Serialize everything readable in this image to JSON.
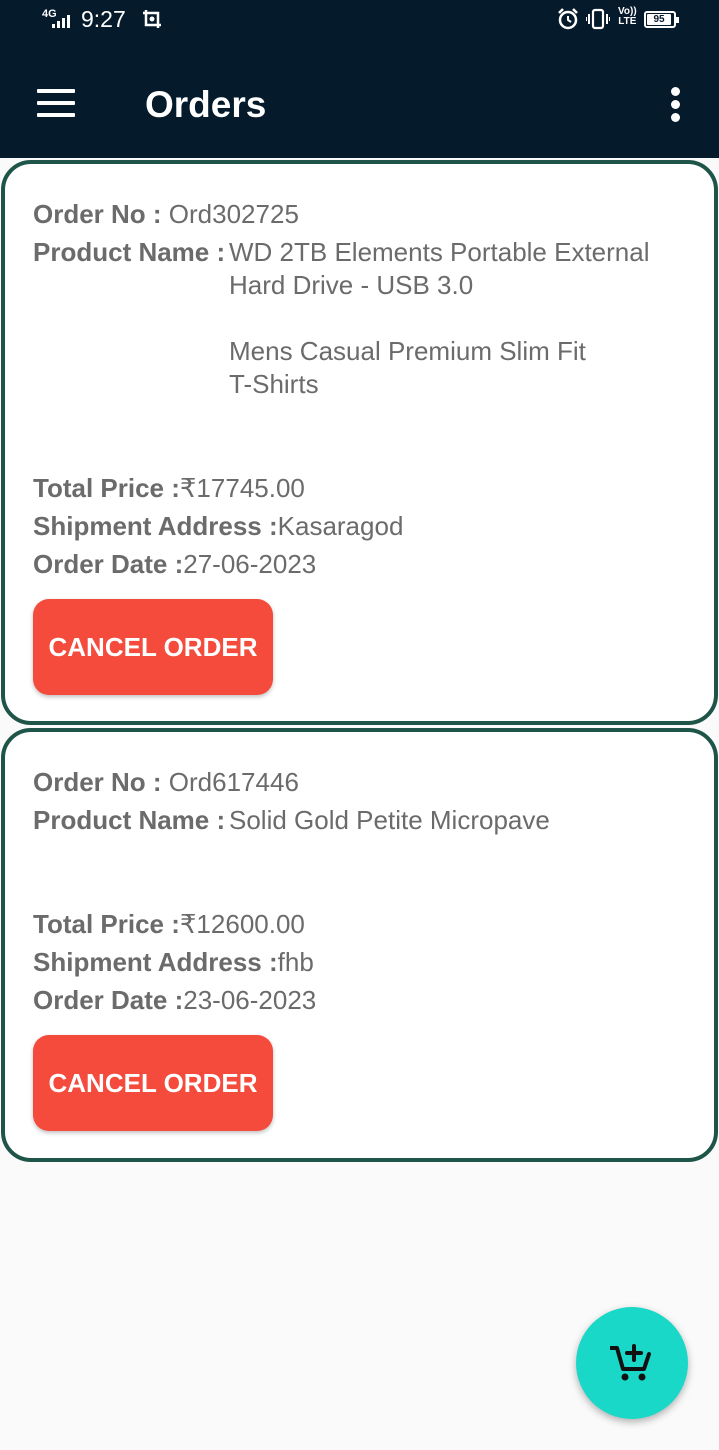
{
  "status_bar": {
    "network": "4G",
    "time": "9:27",
    "volte_top": "Vo))",
    "volte_bottom": "LTE",
    "battery": "95"
  },
  "app_bar": {
    "title": "Orders",
    "menu_icon": "hamburger-menu-icon",
    "more_icon": "more-vertical-icon"
  },
  "orders": [
    {
      "order_no_label": "Order No : ",
      "order_no": "Ord302725",
      "product_name_label": "Product Name :",
      "products": [
        "WD 2TB Elements Portable External",
        "Hard Drive - USB 3.0",
        "Mens Casual Premium Slim Fit",
        "T-Shirts"
      ],
      "total_price_label": "Total Price :",
      "total_price": "₹17745.00",
      "shipment_address_label": "Shipment Address :",
      "shipment_address": "Kasaragod",
      "order_date_label": "Order Date :",
      "order_date": "27-06-2023",
      "cancel_label": "CANCEL ORDER"
    },
    {
      "order_no_label": "Order No : ",
      "order_no": "Ord617446",
      "product_name_label": "Product Name :",
      "products": [
        "Solid Gold Petite Micropave"
      ],
      "total_price_label": "Total Price :",
      "total_price": "₹12600.00",
      "shipment_address_label": "Shipment Address :",
      "shipment_address": "fhb",
      "order_date_label": "Order Date :",
      "order_date": "23-06-2023",
      "cancel_label": "CANCEL ORDER"
    }
  ],
  "fab": {
    "icon": "add-to-cart-icon"
  },
  "colors": {
    "app_bar": "#051a2b",
    "card_border": "#1f5548",
    "cancel_button": "#f44b3c",
    "fab": "#1ad8c8"
  }
}
